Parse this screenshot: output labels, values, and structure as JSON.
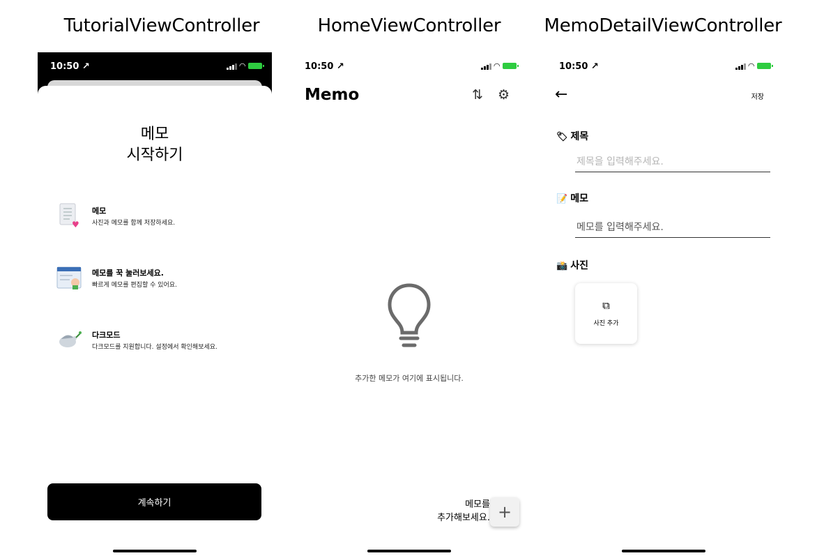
{
  "captions": {
    "tutorial": "TutorialViewController",
    "home": "HomeViewController",
    "detail": "MemoDetailViewController"
  },
  "status_bar": {
    "time": "10:50 ↗"
  },
  "tutorial": {
    "title_line1": "메모",
    "title_line2": "시작하기",
    "features": [
      {
        "icon": "memo-list-heart-icon",
        "title": "메모",
        "desc": "사진과 메모를 함께 저장하세요."
      },
      {
        "icon": "press-hand-icon",
        "title": "메모를 꾹 눌러보세요.",
        "desc": "빠르게 메모를 편집할 수 있어요."
      },
      {
        "icon": "dove-icon",
        "title": "다크모드",
        "desc": "다크모드를 지원합니다. 설정에서 확인해보세요."
      }
    ],
    "continue_label": "계속하기"
  },
  "home": {
    "title": "Memo",
    "sort_icon": "sort-arrows-icon",
    "settings_icon": "gear-icon",
    "empty_text": "추가한 메모가 여기에 표시됩니다.",
    "add_hint_line1": "메모를",
    "add_hint_line2": "추가해보세요.",
    "add_button_label": "+"
  },
  "detail": {
    "save_label": "저장",
    "title_section": "제목",
    "title_placeholder": "제목을 입력해주세요.",
    "memo_section": "메모",
    "memo_placeholder": "메모를 입력해주세요.",
    "photo_section": "사진",
    "add_photo_label": "사진 추가"
  }
}
